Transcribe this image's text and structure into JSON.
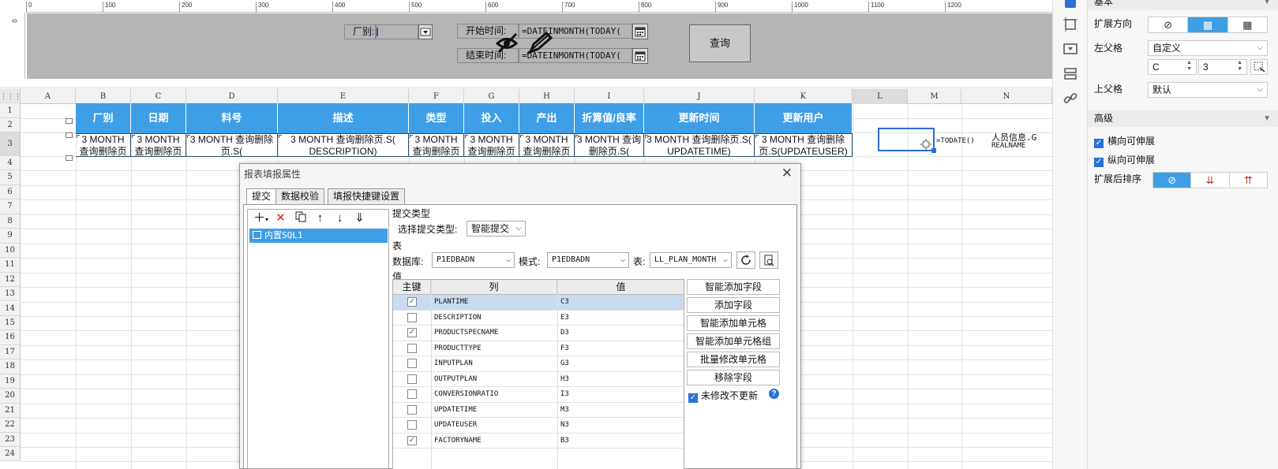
{
  "param_area": {
    "ruler_ticks": [
      "0",
      "100",
      "200",
      "300",
      "400",
      "500",
      "600",
      "700",
      "800",
      "900",
      "1000",
      "1100",
      "1200"
    ],
    "left_ruler": "0",
    "factory_label": "厂别:",
    "factory_value": "",
    "start_label": "开始时间:",
    "start_value": "=DATEINMONTH(TODAY(",
    "end_label": "结束时间:",
    "end_value": "=DATEINMONTH(TODAY(",
    "query_button": "查询"
  },
  "grid": {
    "columns": [
      "A",
      "B",
      "C",
      "D",
      "E",
      "F",
      "G",
      "H",
      "I",
      "J",
      "K",
      "L",
      "M",
      "N"
    ],
    "rows": [
      "1",
      "2",
      "3",
      "4",
      "5",
      "6",
      "7",
      "8",
      "9",
      "10",
      "11",
      "12",
      "13",
      "14",
      "15",
      "16",
      "17",
      "18",
      "19",
      "20",
      "21",
      "22",
      "23",
      "24"
    ],
    "headers": [
      "厂别",
      "日期",
      "料号",
      "描述",
      "类型",
      "投入",
      "产出",
      "折算值/良率",
      "更新时间",
      "更新用户"
    ],
    "data_cells": [
      "3 MONTH 查询删除页",
      "3 MONTH 查询删除页",
      "3 MONTH 查询删除页.S(",
      "3 MONTH 查询删除页.S( DESCRIPTION)",
      "3 MONTH 查询删除页",
      "3 MONTH 查询删除页",
      "3 MONTH 查询删除页",
      "3 MONTH 查询删除页.S(",
      "3 MONTH 查询删除页.S( UPDATETIME)",
      "3 MONTH 查询删除页.S(UPDATEUSER)"
    ],
    "m3_formula": "=TODATE()",
    "n3_text_1": "人员信息.G",
    "n3_text_2": "REALNAME"
  },
  "dialog": {
    "title": "报表填报属性",
    "tabs": [
      "提交",
      "数据校验",
      "填报快捷键设置"
    ],
    "list_item": "内置SQL1",
    "submit_type_section": "提交类型",
    "submit_type_label": "选择提交类型:",
    "submit_type_value": "智能提交",
    "table_section": "表",
    "db_label": "数据库:",
    "db_value": "P1EDBADN",
    "schema_label": "模式:",
    "schema_value": "P1EDBADN",
    "table_label": "表:",
    "table_value": "LL_PLAN_MONTH",
    "value_section": "值",
    "col_headers": [
      "主键",
      "列",
      "值"
    ],
    "fields": [
      {
        "checked": true,
        "column": "PLANTIME",
        "value": "C3"
      },
      {
        "checked": false,
        "column": "DESCRIPTION",
        "value": "E3"
      },
      {
        "checked": true,
        "column": "PRODUCTSPECNAME",
        "value": "D3"
      },
      {
        "checked": false,
        "column": "PRODUCTTYPE",
        "value": "F3"
      },
      {
        "checked": false,
        "column": "INPUTPLAN",
        "value": "G3"
      },
      {
        "checked": false,
        "column": "OUTPUTPLAN",
        "value": "H3"
      },
      {
        "checked": false,
        "column": "CONVERSIONRATIO",
        "value": "I3"
      },
      {
        "checked": false,
        "column": "UPDATETIME",
        "value": "M3"
      },
      {
        "checked": false,
        "column": "UPDATEUSER",
        "value": "N3"
      },
      {
        "checked": true,
        "column": "FACTORYNAME",
        "value": "B3"
      }
    ],
    "buttons": [
      "智能添加字段",
      "添加字段",
      "智能添加单元格",
      "智能添加单元格组",
      "批量修改单元格",
      "移除字段"
    ],
    "no_change_label": "未修改不更新",
    "help": "?"
  },
  "props": {
    "basic_header": "基本",
    "expand_dir_label": "扩展方向",
    "left_parent_label": "左父格",
    "left_parent_value": "自定义",
    "left_parent_col": "C",
    "left_parent_row": "3",
    "up_parent_label": "上父格",
    "up_parent_value": "默认",
    "advanced_header": "高级",
    "h_stretch": "横向可伸展",
    "v_stretch": "纵向可伸展",
    "sort_label": "扩展后排序"
  },
  "accent": "#3e9ee6"
}
